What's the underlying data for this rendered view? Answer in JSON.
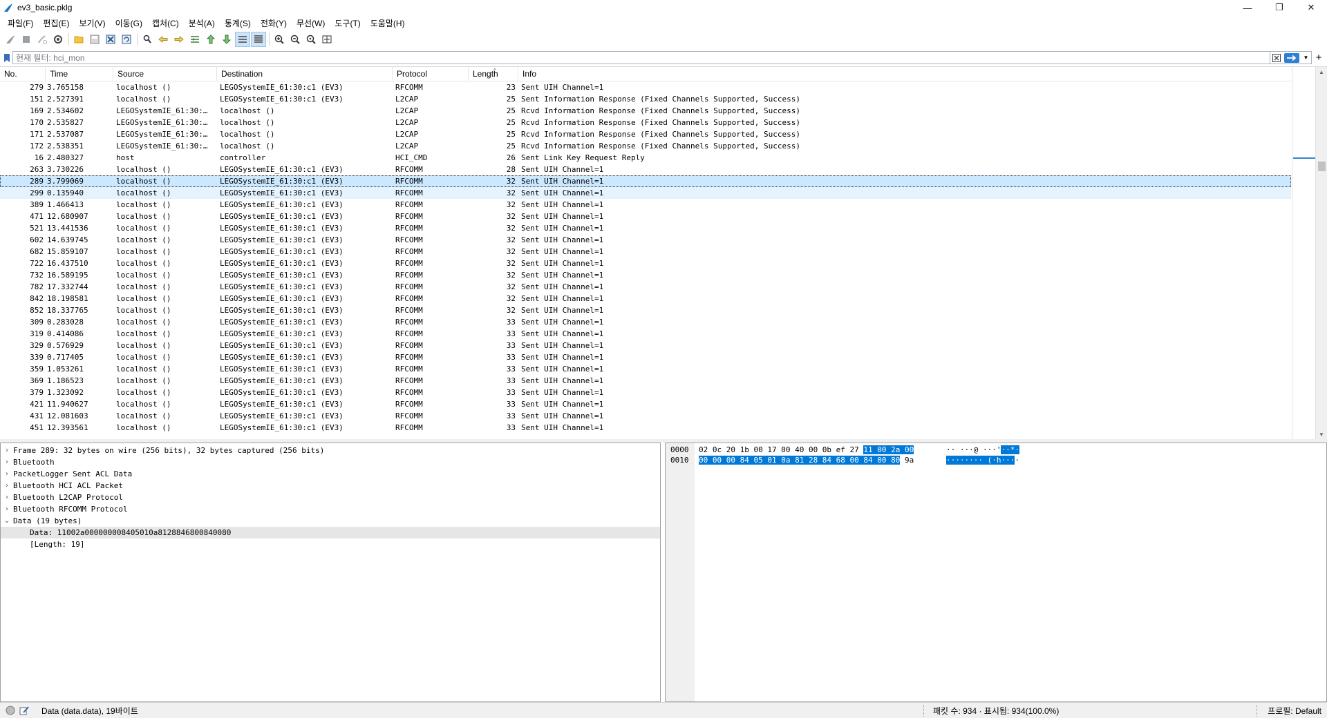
{
  "window": {
    "title": "ev3_basic.pklg",
    "minimize": "—",
    "restore": "❐",
    "close": "✕"
  },
  "menu": [
    "파일(F)",
    "편집(E)",
    "보기(V)",
    "이동(G)",
    "캡처(C)",
    "분석(A)",
    "통계(S)",
    "전화(Y)",
    "무선(W)",
    "도구(T)",
    "도움말(H)"
  ],
  "filter": {
    "placeholder": "현재 필터: hci_mon",
    "value": ""
  },
  "packet_list": {
    "columns": [
      "No.",
      "Time",
      "Source",
      "Destination",
      "Protocol",
      "Length",
      "Info"
    ],
    "selected_no": "289",
    "rows": [
      [
        "279",
        "3.765158",
        "localhost ()",
        "LEGOSystemIE_61:30:c1 (EV3)",
        "RFCOMM",
        "23",
        "Sent UIH Channel=1"
      ],
      [
        "151",
        "2.527391",
        "localhost ()",
        "LEGOSystemIE_61:30:c1 (EV3)",
        "L2CAP",
        "25",
        "Sent Information Response (Fixed Channels Supported, Success)"
      ],
      [
        "169",
        "2.534602",
        "LEGOSystemIE_61:30:…",
        "localhost ()",
        "L2CAP",
        "25",
        "Rcvd Information Response (Fixed Channels Supported, Success)"
      ],
      [
        "170",
        "2.535827",
        "LEGOSystemIE_61:30:…",
        "localhost ()",
        "L2CAP",
        "25",
        "Rcvd Information Response (Fixed Channels Supported, Success)"
      ],
      [
        "171",
        "2.537087",
        "LEGOSystemIE_61:30:…",
        "localhost ()",
        "L2CAP",
        "25",
        "Rcvd Information Response (Fixed Channels Supported, Success)"
      ],
      [
        "172",
        "2.538351",
        "LEGOSystemIE_61:30:…",
        "localhost ()",
        "L2CAP",
        "25",
        "Rcvd Information Response (Fixed Channels Supported, Success)"
      ],
      [
        "16",
        "2.480327",
        "host",
        "controller",
        "HCI_CMD",
        "26",
        "Sent Link Key Request Reply"
      ],
      [
        "263",
        "3.730226",
        "localhost ()",
        "LEGOSystemIE_61:30:c1 (EV3)",
        "RFCOMM",
        "28",
        "Sent UIH Channel=1"
      ],
      [
        "289",
        "3.799069",
        "localhost ()",
        "LEGOSystemIE_61:30:c1 (EV3)",
        "RFCOMM",
        "32",
        "Sent UIH Channel=1"
      ],
      [
        "299",
        "0.135940",
        "localhost ()",
        "LEGOSystemIE_61:30:c1 (EV3)",
        "RFCOMM",
        "32",
        "Sent UIH Channel=1"
      ],
      [
        "389",
        "1.466413",
        "localhost ()",
        "LEGOSystemIE_61:30:c1 (EV3)",
        "RFCOMM",
        "32",
        "Sent UIH Channel=1"
      ],
      [
        "471",
        "12.680907",
        "localhost ()",
        "LEGOSystemIE_61:30:c1 (EV3)",
        "RFCOMM",
        "32",
        "Sent UIH Channel=1"
      ],
      [
        "521",
        "13.441536",
        "localhost ()",
        "LEGOSystemIE_61:30:c1 (EV3)",
        "RFCOMM",
        "32",
        "Sent UIH Channel=1"
      ],
      [
        "602",
        "14.639745",
        "localhost ()",
        "LEGOSystemIE_61:30:c1 (EV3)",
        "RFCOMM",
        "32",
        "Sent UIH Channel=1"
      ],
      [
        "682",
        "15.859107",
        "localhost ()",
        "LEGOSystemIE_61:30:c1 (EV3)",
        "RFCOMM",
        "32",
        "Sent UIH Channel=1"
      ],
      [
        "722",
        "16.437510",
        "localhost ()",
        "LEGOSystemIE_61:30:c1 (EV3)",
        "RFCOMM",
        "32",
        "Sent UIH Channel=1"
      ],
      [
        "732",
        "16.589195",
        "localhost ()",
        "LEGOSystemIE_61:30:c1 (EV3)",
        "RFCOMM",
        "32",
        "Sent UIH Channel=1"
      ],
      [
        "782",
        "17.332744",
        "localhost ()",
        "LEGOSystemIE_61:30:c1 (EV3)",
        "RFCOMM",
        "32",
        "Sent UIH Channel=1"
      ],
      [
        "842",
        "18.198581",
        "localhost ()",
        "LEGOSystemIE_61:30:c1 (EV3)",
        "RFCOMM",
        "32",
        "Sent UIH Channel=1"
      ],
      [
        "852",
        "18.337765",
        "localhost ()",
        "LEGOSystemIE_61:30:c1 (EV3)",
        "RFCOMM",
        "32",
        "Sent UIH Channel=1"
      ],
      [
        "309",
        "0.283028",
        "localhost ()",
        "LEGOSystemIE_61:30:c1 (EV3)",
        "RFCOMM",
        "33",
        "Sent UIH Channel=1"
      ],
      [
        "319",
        "0.414086",
        "localhost ()",
        "LEGOSystemIE_61:30:c1 (EV3)",
        "RFCOMM",
        "33",
        "Sent UIH Channel=1"
      ],
      [
        "329",
        "0.576929",
        "localhost ()",
        "LEGOSystemIE_61:30:c1 (EV3)",
        "RFCOMM",
        "33",
        "Sent UIH Channel=1"
      ],
      [
        "339",
        "0.717405",
        "localhost ()",
        "LEGOSystemIE_61:30:c1 (EV3)",
        "RFCOMM",
        "33",
        "Sent UIH Channel=1"
      ],
      [
        "359",
        "1.053261",
        "localhost ()",
        "LEGOSystemIE_61:30:c1 (EV3)",
        "RFCOMM",
        "33",
        "Sent UIH Channel=1"
      ],
      [
        "369",
        "1.186523",
        "localhost ()",
        "LEGOSystemIE_61:30:c1 (EV3)",
        "RFCOMM",
        "33",
        "Sent UIH Channel=1"
      ],
      [
        "379",
        "1.323092",
        "localhost ()",
        "LEGOSystemIE_61:30:c1 (EV3)",
        "RFCOMM",
        "33",
        "Sent UIH Channel=1"
      ],
      [
        "421",
        "11.940627",
        "localhost ()",
        "LEGOSystemIE_61:30:c1 (EV3)",
        "RFCOMM",
        "33",
        "Sent UIH Channel=1"
      ],
      [
        "431",
        "12.081603",
        "localhost ()",
        "LEGOSystemIE_61:30:c1 (EV3)",
        "RFCOMM",
        "33",
        "Sent UIH Channel=1"
      ],
      [
        "451",
        "12.393561",
        "localhost ()",
        "LEGOSystemIE_61:30:c1 (EV3)",
        "RFCOMM",
        "33",
        "Sent UIH Channel=1"
      ]
    ]
  },
  "details": [
    {
      "text": "Frame 289: 32 bytes on wire (256 bits), 32 bytes captured (256 bits)",
      "expander": "›",
      "child": false,
      "hl": false
    },
    {
      "text": "Bluetooth",
      "expander": "›",
      "child": false,
      "hl": false
    },
    {
      "text": "PacketLogger Sent ACL Data",
      "expander": "›",
      "child": false,
      "hl": false
    },
    {
      "text": "Bluetooth HCI ACL Packet",
      "expander": "›",
      "child": false,
      "hl": false
    },
    {
      "text": "Bluetooth L2CAP Protocol",
      "expander": "›",
      "child": false,
      "hl": false
    },
    {
      "text": "Bluetooth RFCOMM Protocol",
      "expander": "›",
      "child": false,
      "hl": false
    },
    {
      "text": "Data (19 bytes)",
      "expander": "⌄",
      "child": false,
      "hl": false
    },
    {
      "text": "Data: 11002a000000008405010a8128846800840080",
      "expander": "",
      "child": true,
      "hl": true
    },
    {
      "text": "[Length: 19]",
      "expander": "",
      "child": true,
      "hl": false
    }
  ],
  "bytes": [
    {
      "offset": "0000",
      "hex_plain": "02 0c 20 1b 00 17 00 40  00 0b ef 27 ",
      "hex_hl": "11 00 2a 00",
      "hex_tail": "",
      "ascii_plain": "·· ···@ ···'",
      "ascii_hl": "··*·",
      "ascii_tail": ""
    },
    {
      "offset": "0010",
      "hex_plain": "",
      "hex_hl": "00 00 00 84 05 01 0a 81  28 84 68 00 84 00 80",
      "hex_tail": " 9a",
      "ascii_plain": "",
      "ascii_hl": "········ (·h···",
      "ascii_tail": "·"
    }
  ],
  "status": {
    "field": "Data (data.data), 19바이트",
    "packets": "패킷 수: 934 · 표시됨: 934(100.0%)",
    "profile": "프로필: Default"
  }
}
